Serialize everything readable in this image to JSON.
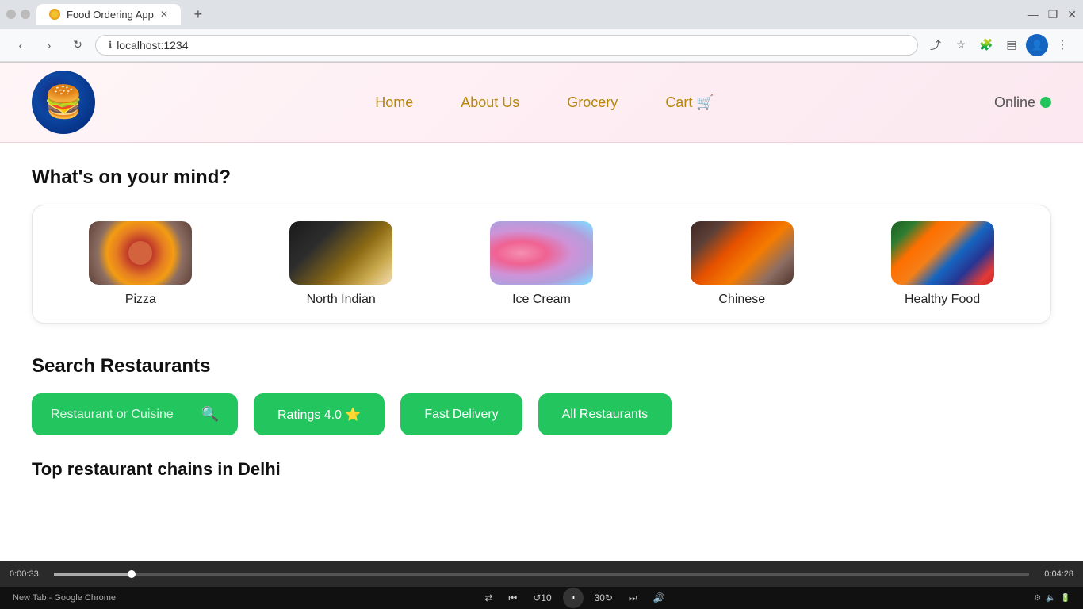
{
  "browser": {
    "tab_title": "Food Ordering App",
    "url": "localhost:1234",
    "new_tab_symbol": "+",
    "back_symbol": "‹",
    "forward_symbol": "›",
    "reload_symbol": "↻"
  },
  "navbar": {
    "logo_emoji": "🍔",
    "links": [
      {
        "id": "home",
        "label": "Home"
      },
      {
        "id": "about",
        "label": "About Us"
      },
      {
        "id": "grocery",
        "label": "Grocery"
      },
      {
        "id": "cart",
        "label": "Cart 🛒"
      }
    ],
    "status_label": "Online",
    "status_color": "#22c55e"
  },
  "categories_section": {
    "title": "What's on your mind?",
    "items": [
      {
        "id": "pizza",
        "label": "Pizza",
        "css_class": "pizza-img"
      },
      {
        "id": "north-indian",
        "label": "North Indian",
        "css_class": "north-indian-img"
      },
      {
        "id": "ice-cream",
        "label": "Ice Cream",
        "css_class": "ice-cream-img"
      },
      {
        "id": "chinese",
        "label": "Chinese",
        "css_class": "chinese-img"
      },
      {
        "id": "healthy",
        "label": "Healthy Food",
        "css_class": "healthy-img"
      }
    ]
  },
  "search_section": {
    "title": "Search Restaurants",
    "input_placeholder": "Restaurant or Cuisine",
    "filters": [
      {
        "id": "ratings",
        "label": "Ratings 4.0 ⭐"
      },
      {
        "id": "fast-delivery",
        "label": "Fast Delivery"
      },
      {
        "id": "all-restaurants",
        "label": "All Restaurants"
      }
    ]
  },
  "top_section": {
    "title": "Top restaurant chains in Delhi"
  },
  "media_bar": {
    "time_elapsed": "0:00:33",
    "time_remaining": "0:04:28",
    "progress_pct": 8
  }
}
